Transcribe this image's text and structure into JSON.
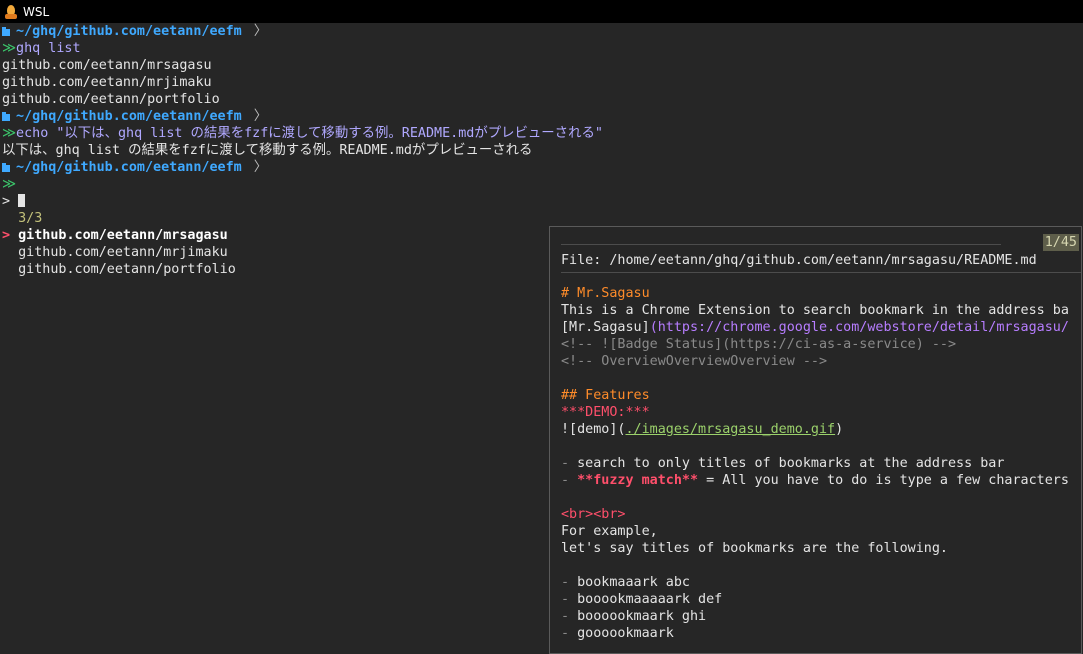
{
  "window": {
    "title": "WSL"
  },
  "prompt_path": "~/ghq/github.com/eetann/eefm",
  "prompt_chevron": "〉",
  "arrows": "≫",
  "cmd1": "ghq list",
  "list_out": [
    "github.com/eetann/mrsagasu",
    "github.com/eetann/mrjimaku",
    "github.com/eetann/portfolio"
  ],
  "cmd2": "echo \"以下は、ghq list の結果をfzfに渡して移動する例。README.mdがプレビューされる\"",
  "echo_out": "以下は、ghq list の結果をfzfに渡して移動する例。README.mdがプレビューされる",
  "fzf": {
    "prompt": ">",
    "counter": "3/3",
    "pointer": ">",
    "items": [
      "github.com/eetann/mrsagasu",
      "github.com/eetann/mrjimaku",
      "github.com/eetann/portfolio"
    ]
  },
  "preview": {
    "position": "1/45",
    "file": "File: /home/eetann/ghq/github.com/eetann/mrsagasu/README.md",
    "h1": "# Mr.Sagasu",
    "desc": "This is a Chrome Extension to search bookmark in the address ba",
    "link_text": "[Mr.Sagasu]",
    "link_url": "(https://chrome.google.com/webstore/detail/mrsagasu/",
    "comment1": "<!-- ![Badge Status](https://ci-as-a-service) -->",
    "comment2": "<!-- OverviewOverviewOverview -->",
    "h2": "## Features",
    "demo": "***DEMO:***",
    "img_prefix": "![demo](",
    "img_path": "./images/mrsagasu_demo.gif",
    "img_suffix": ")",
    "bullet1": "search to only titles of bookmarks at the address bar",
    "bullet2_bold": "**fuzzy match**",
    "bullet2_rest": " = All you have to do is type a few characters",
    "br_tags": "<br><br>",
    "example1": "For example,",
    "example2": "let's say titles of bookmarks are the following.",
    "bm": [
      "bookmaaark abc",
      "booookmaaaaark def",
      "boooookmaark ghi",
      "goooookmaark"
    ],
    "dash": "-"
  }
}
